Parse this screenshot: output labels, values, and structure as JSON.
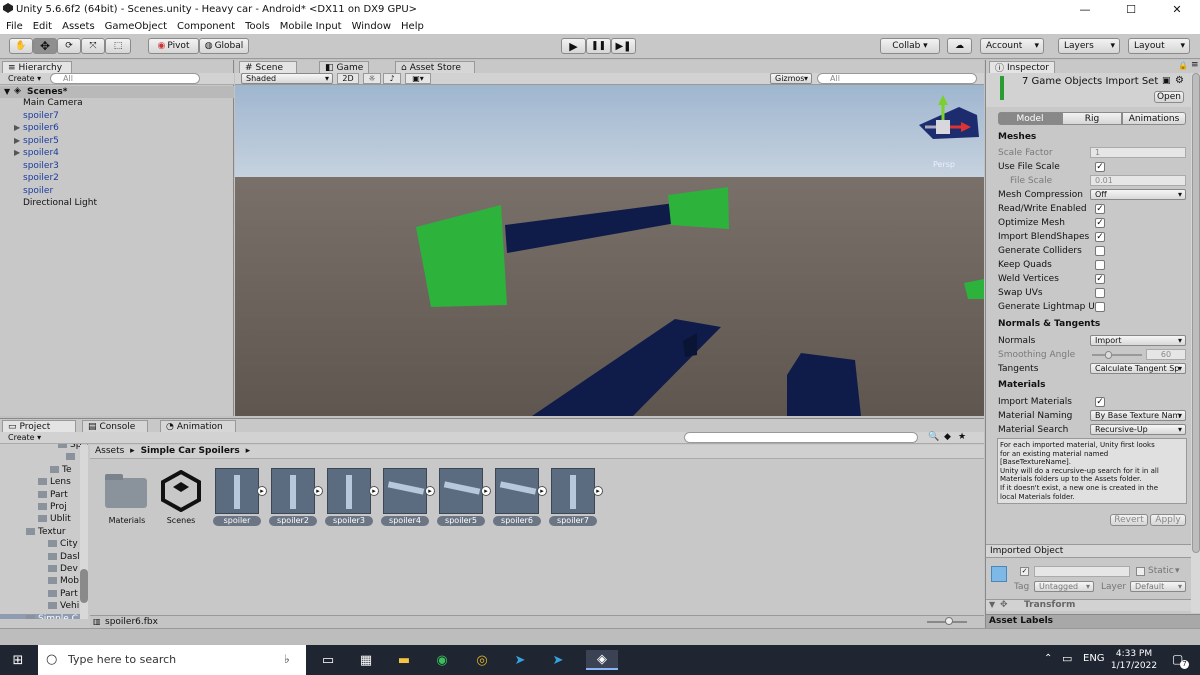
{
  "window": {
    "title": "Unity 5.6.6f2 (64bit) - Scenes.unity - Heavy car - Android* <DX11 on DX9 GPU>",
    "minimize": "—",
    "maximize": "☐",
    "close": "✕"
  },
  "menu": [
    "File",
    "Edit",
    "Assets",
    "GameObject",
    "Component",
    "Tools",
    "Mobile Input",
    "Window",
    "Help"
  ],
  "toolbar": {
    "pivot": "Pivot",
    "global": "Global",
    "collab": "Collab ▾",
    "account": "Account",
    "layers": "Layers",
    "layout": "Layout"
  },
  "hierarchy": {
    "tab": "Hierarchy",
    "create": "Create ▾",
    "search_placeholder": "All",
    "scene": "Scenes*",
    "items": [
      {
        "label": "Main Camera",
        "blue": false,
        "expand": false
      },
      {
        "label": "spoiler7",
        "blue": true,
        "expand": false
      },
      {
        "label": "spoiler6",
        "blue": true,
        "expand": true
      },
      {
        "label": "spoiler5",
        "blue": true,
        "expand": true
      },
      {
        "label": "spoiler4",
        "blue": true,
        "expand": true
      },
      {
        "label": "spoiler3",
        "blue": true,
        "expand": false
      },
      {
        "label": "spoiler2",
        "blue": true,
        "expand": false
      },
      {
        "label": "spoiler",
        "blue": true,
        "expand": false
      },
      {
        "label": "Directional Light",
        "blue": false,
        "expand": false
      }
    ]
  },
  "scene_view": {
    "tabs": [
      "Scene",
      "Game",
      "Asset Store"
    ],
    "shading": "Shaded",
    "mode_2d": "2D",
    "gizmos": "Gizmos",
    "search_placeholder": "All",
    "persp": "Persp"
  },
  "inspector": {
    "tab": "Inspector",
    "title": "7 Game Objects Import Set",
    "open": "Open",
    "tabs": [
      "Model",
      "Rig",
      "Animations"
    ],
    "meshes_header": "Meshes",
    "scale_factor_label": "Scale Factor",
    "scale_factor_value": "1",
    "use_file_scale": "Use File Scale",
    "file_scale_label": "File Scale",
    "file_scale_value": "0.01",
    "mesh_compression_label": "Mesh Compression",
    "mesh_compression_value": "Off",
    "read_write": "Read/Write Enabled",
    "optimize_mesh": "Optimize Mesh",
    "import_blendshapes": "Import BlendShapes",
    "generate_colliders": "Generate Colliders",
    "keep_quads": "Keep Quads",
    "weld_vertices": "Weld Vertices",
    "swap_uvs": "Swap UVs",
    "generate_lightmap": "Generate Lightmap U",
    "normals_header": "Normals & Tangents",
    "normals_label": "Normals",
    "normals_value": "Import",
    "smoothing_label": "Smoothing Angle",
    "smoothing_value": "60",
    "tangents_label": "Tangents",
    "tangents_value": "Calculate Tangent Sp",
    "materials_header": "Materials",
    "import_materials": "Import Materials",
    "material_naming_label": "Material Naming",
    "material_naming_value": "By Base Texture Nam",
    "material_search_label": "Material Search",
    "material_search_value": "Recursive-Up",
    "help_lines": [
      "For each imported material, Unity first looks",
      "for an existing material named",
      "[BaseTextureName].",
      "Unity will do a recursive-up search for it in all",
      "Materials folders up to the Assets folder.",
      "If it doesn't exist, a new one is created in the",
      "local Materials folder."
    ],
    "revert": "Revert",
    "apply": "Apply",
    "imported_object": "Imported Object",
    "static": "Static",
    "tag_label": "Tag",
    "tag_value": "Untagged",
    "layer_label": "Layer",
    "layer_value": "Default",
    "transform": "Transform",
    "asset_labels": "Asset Labels"
  },
  "checks": {
    "use_file_scale": true,
    "read_write": true,
    "optimize_mesh": true,
    "import_blendshapes": true,
    "generate_colliders": false,
    "keep_quads": false,
    "weld_vertices": true,
    "swap_uvs": false,
    "generate_lightmap": false,
    "import_materials": true
  },
  "project": {
    "tabs": [
      "Project",
      "Console",
      "Animation"
    ],
    "create": "Create ▾",
    "breadcrumb_root": "Assets",
    "breadcrumb_sep": "▸",
    "breadcrumb_folder": "Simple Car Spoilers",
    "tree": [
      "Sp",
      "",
      "Te",
      "Lens",
      "Part",
      "Proj",
      "Ublit",
      "Textur",
      "City",
      "Dasl",
      "Dev",
      "Mob",
      "Part",
      "Vehi",
      "Simple C"
    ],
    "assets": [
      "Materials",
      "Scenes",
      "spoiler",
      "spoiler2",
      "spoiler3",
      "spoiler4",
      "spoiler5",
      "spoiler6",
      "spoiler7"
    ],
    "status_file": "spoiler6.fbx"
  },
  "taskbar": {
    "search_placeholder": "Type here to search",
    "lang": "ENG",
    "time": "4:33 PM",
    "date": "1/17/2022",
    "notif": "7"
  },
  "colors": {
    "green_spoiler": "#2db23b",
    "navy_spoiler": "#0f1c4a",
    "sky": "#b4c8dc",
    "ground": "#6c625c"
  }
}
